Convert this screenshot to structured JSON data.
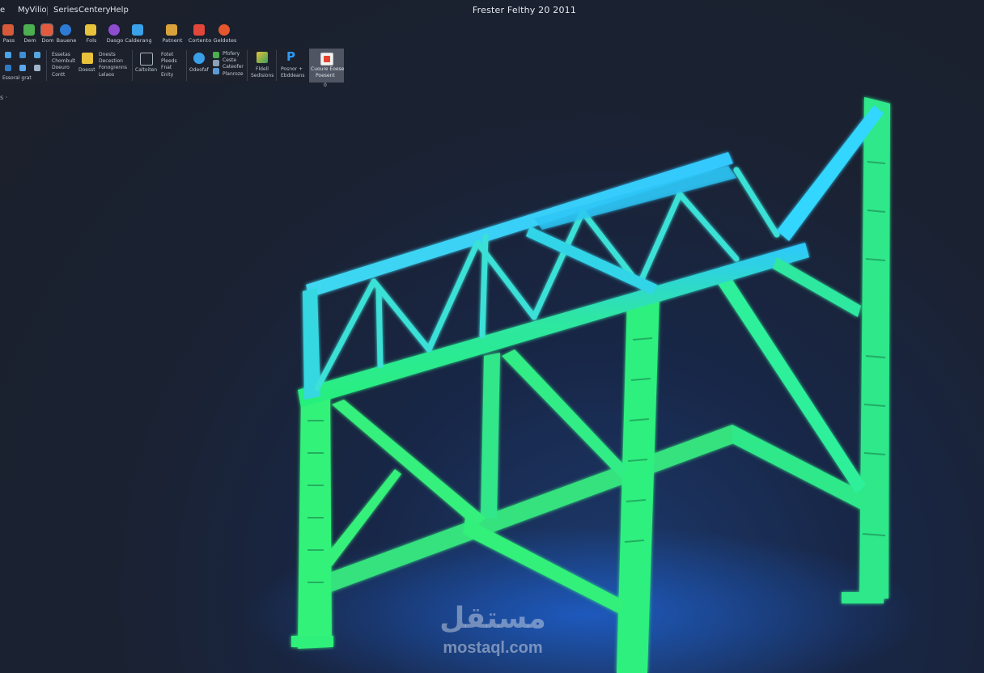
{
  "menubar": {
    "items": [
      "e",
      "MyVilio",
      "Series",
      "Centery",
      "Help"
    ]
  },
  "window": {
    "title": "Frester Felthy 20 2011"
  },
  "ribbon": {
    "row1": [
      {
        "label": "Pass",
        "icon": "tools-icon",
        "color": "#d65a3a"
      },
      {
        "label": "Dem",
        "icon": "shapes-icon",
        "color": "#4caf50"
      },
      {
        "label": "Dom",
        "icon": "chart-icon",
        "color": "#e35b3f",
        "active": true
      },
      {
        "label": "Bauene",
        "icon": "globe-icon",
        "color": "#2e7bd6"
      },
      {
        "label": "Fols",
        "icon": "folder-icon",
        "color": "#e8c23a"
      },
      {
        "label": "Dasgo",
        "icon": "purple-circle-icon",
        "color": "#8e4ccf"
      },
      {
        "label": "Calderang",
        "icon": "cube-icon",
        "color": "#3aa0e8"
      },
      {
        "label": "Patnent",
        "icon": "gear-icon",
        "color": "#d9a23a"
      },
      {
        "label": "Cortento",
        "icon": "document-icon",
        "color": "#e0473a"
      },
      {
        "label": "Geldotes",
        "icon": "chrome-icon",
        "color": "#e4562e"
      }
    ],
    "group1": {
      "label": "Essoral grat"
    },
    "group2": {
      "lines": [
        "Essetas",
        "Chombult",
        "Doeuro",
        "Contt"
      ]
    },
    "group3": {
      "label": "Doesst"
    },
    "group4": {
      "lines": [
        "Dnests",
        "Decestion",
        "Fonogrenns",
        "Lelaos"
      ]
    },
    "group5": {
      "label": "Caltoiten"
    },
    "group6": {
      "lines": [
        "Fotet",
        "Pleeds",
        "Fnat",
        "Enity"
      ]
    },
    "group7": {
      "label": "Odeofaf"
    },
    "group8": {
      "lines": [
        "Pfofery",
        "Ceste",
        "Cateofer",
        "Planroze"
      ]
    },
    "group9": {
      "lines": [
        "Fldell",
        "Sedisions"
      ]
    },
    "group10": {
      "lines": [
        "Posnor +",
        "Ebddeans"
      ]
    },
    "group11": {
      "lines": [
        "Cuoure Eoese",
        "Poesent"
      ],
      "badge": "0"
    }
  },
  "subrow": {
    "text": "s ·"
  },
  "viewport": {
    "description_colors": {
      "top": "#2ec8ff",
      "bottom": "#27f07a",
      "glow": "#1f74ff"
    }
  },
  "watermark": {
    "arabic": "مستقل",
    "latin": "mostaql.com"
  }
}
